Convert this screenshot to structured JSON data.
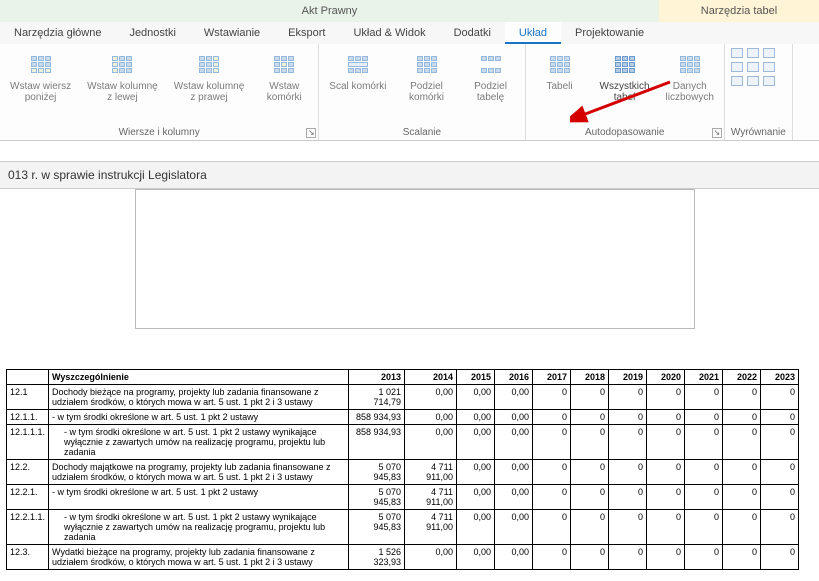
{
  "ribbon": {
    "main_title": "Akt Prawny",
    "tools_title": "Narzędzia tabel",
    "tabs": [
      "Narzędzia główne",
      "Jednostki",
      "Wstawianie",
      "Eksport",
      "Układ & Widok",
      "Dodatki",
      "Układ",
      "Projektowanie"
    ],
    "active_tab": "Układ",
    "groups": {
      "rows_cols": {
        "label": "Wiersze i kolumny",
        "insert_row_below": "Wstaw wiersz\nponiżej",
        "insert_col_left": "Wstaw kolumnę\nz lewej",
        "insert_col_right": "Wstaw kolumnę\nz prawej",
        "insert_cells": "Wstaw\nkomórki"
      },
      "merge": {
        "label": "Scalanie",
        "merge_cells": "Scal komórki",
        "split_cells": "Podziel\nkomórki",
        "split_table": "Podziel\ntabelę"
      },
      "autofit": {
        "label": "Autodopasowanie",
        "fit_table": "Tabeli",
        "fit_all_tables": "Wszystkich\ntabel",
        "fit_numeric": "Danych\nliczbowych"
      },
      "align": {
        "label": "Wyrównanie"
      }
    }
  },
  "doc_title": "013 r. w sprawie instrukcji Legislatora",
  "table": {
    "header": {
      "desc": "Wyszczególnienie",
      "years": [
        "2013",
        "2014",
        "2015",
        "2016",
        "2017",
        "2018",
        "2019",
        "2020",
        "2021",
        "2022",
        "2023"
      ]
    },
    "rows": [
      {
        "code": "12.1",
        "desc": "Dochody bieżące na programy, projekty lub zadania finansowane z udziałem środków, o których mowa w art. 5 ust. 1 pkt 2 i 3 ustawy",
        "vals": [
          "1 021 714,79",
          "0,00",
          "0,00",
          "0,00",
          "0",
          "0",
          "0",
          "0",
          "0",
          "0",
          "0"
        ]
      },
      {
        "code": "12.1.1.",
        "desc": "- w tym środki określone w art. 5 ust. 1 pkt 2 ustawy",
        "vals": [
          "858 934,93",
          "0,00",
          "0,00",
          "0,00",
          "0",
          "0",
          "0",
          "0",
          "0",
          "0",
          "0"
        ]
      },
      {
        "code": "12.1.1.1.",
        "desc": "- w tym środki określone w art. 5 ust. 1 pkt 2 ustawy wynikające wyłącznie z zawartych umów na realizację programu, projektu lub zadania",
        "indent": true,
        "vals": [
          "858 934,93",
          "0,00",
          "0,00",
          "0,00",
          "0",
          "0",
          "0",
          "0",
          "0",
          "0",
          "0"
        ]
      },
      {
        "code": "12.2.",
        "desc": "Dochody majątkowe na programy, projekty lub zadania finansowane z udziałem środków, o których mowa w art. 5 ust. 1 pkt 2 i 3 ustawy",
        "vals": [
          "5 070 945,83",
          "4 711 911,00",
          "0,00",
          "0,00",
          "0",
          "0",
          "0",
          "0",
          "0",
          "0",
          "0"
        ]
      },
      {
        "code": "12.2.1.",
        "desc": "- w tym środki określone w art. 5 ust. 1 pkt 2 ustawy",
        "vals": [
          "5 070 945,83",
          "4 711 911,00",
          "0,00",
          "0,00",
          "0",
          "0",
          "0",
          "0",
          "0",
          "0",
          "0"
        ]
      },
      {
        "code": "12.2.1.1.",
        "desc": "- w tym środki określone w art. 5 ust. 1 pkt 2 ustawy wynikające wyłącznie z zawartych umów na realizację programu, projektu lub zadania",
        "indent": true,
        "vals": [
          "5 070 945,83",
          "4 711 911,00",
          "0,00",
          "0,00",
          "0",
          "0",
          "0",
          "0",
          "0",
          "0",
          "0"
        ]
      },
      {
        "code": "12.3.",
        "desc": "Wydatki bieżące na programy, projekty lub zadania finansowane z udziałem środków, o których mowa w art. 5 ust. 1 pkt 2 i 3 ustawy",
        "vals": [
          "1 526 323,93",
          "0,00",
          "0,00",
          "0,00",
          "0",
          "0",
          "0",
          "0",
          "0",
          "0",
          "0"
        ]
      }
    ]
  }
}
